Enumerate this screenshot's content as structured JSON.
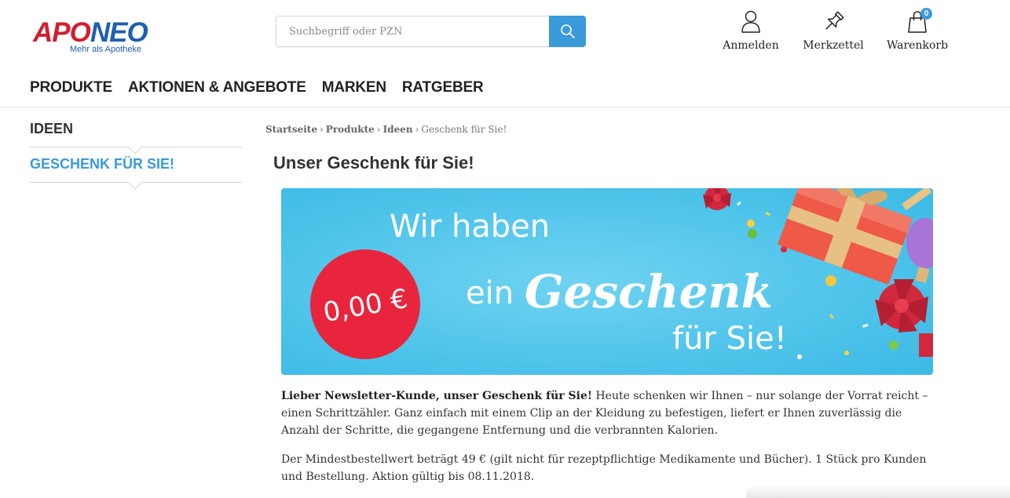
{
  "logo": {
    "part1": "APO",
    "part2": "NEO",
    "tagline": "Mehr als Apotheke"
  },
  "search": {
    "placeholder": "Suchbegriff oder PZN",
    "value": ""
  },
  "user_actions": [
    {
      "label": "Anmelden",
      "icon": "user-icon"
    },
    {
      "label": "Merkzettel",
      "icon": "pin-icon"
    },
    {
      "label": "Warenkorb",
      "icon": "shopping-bag-icon",
      "badge": "0"
    }
  ],
  "main_nav": [
    "PRODUKTE",
    "AKTIONEN & ANGEBOTE",
    "MARKEN",
    "RATGEBER"
  ],
  "sidebar": {
    "items": [
      "IDEEN",
      "GESCHENK FÜR SIE!"
    ]
  },
  "breadcrumb": {
    "items": [
      "Startseite",
      "Produkte",
      "Ideen"
    ],
    "current": "Geschenk für Sie!",
    "separator": "›"
  },
  "page_title": "Unser Geschenk für Sie!",
  "banner": {
    "line1": "Wir haben",
    "line2a": "ein",
    "line2b": "Geschenk",
    "line3": "für Sie!",
    "price": "0,00 €"
  },
  "content": {
    "p1_bold": "Lieber Newsletter-Kunde, unser Geschenk für Sie!",
    "p1_rest": " Heute schenken wir Ihnen – nur solange der Vorrat reicht – einen Schrittzähler. Ganz einfach mit einem Clip an der Kleidung zu befestigen, liefert er Ihnen zuverlässig die Anzahl der Schritte, die gegangene Entfernung und die verbrannten Kalorien.",
    "p2": "Der Mindestbestellwert beträgt 49 € (gilt nicht für rezeptpflichtige Medikamente und Bücher). 1 Stück pro Kunden und Bestellung. Aktion gültig bis 08.11.2018."
  },
  "colors": {
    "brand_red": "#d01f2f",
    "brand_blue": "#1f5fae",
    "accent": "#3b9ad9",
    "banner_bg": "#4cc2ea",
    "price_circle": "#e8253c"
  }
}
